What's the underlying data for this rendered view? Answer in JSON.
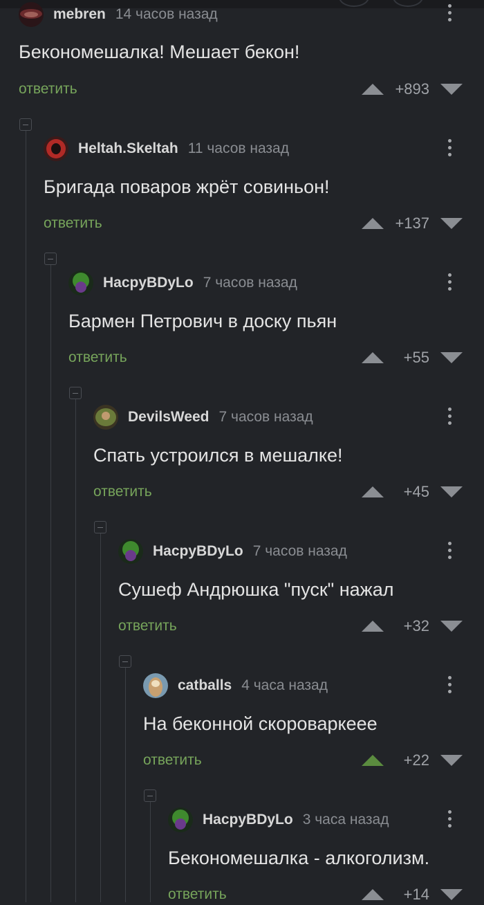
{
  "reply_label": "ответить",
  "colors": {
    "background": "#222428",
    "reply_green": "#77a55b",
    "upvote_active": "#5b8c3f",
    "muted": "#8a8d92"
  },
  "comments": [
    {
      "username": "mebren",
      "time": "14 часов назад",
      "text": "Бекономешалка! Мешает бекон!",
      "score": "+893",
      "upvoted": false,
      "avatar": "mebren-avatar"
    },
    {
      "username": "Heltah.Skeltah",
      "time": "11 часов назад",
      "text": "Бригада поваров жрёт совиньон!",
      "score": "+137",
      "upvoted": false,
      "avatar": "heltah-avatar"
    },
    {
      "username": "HacpyBDyLo",
      "time": "7 часов назад",
      "text": "Бармен Петрович в доску пьян",
      "score": "+55",
      "upvoted": false,
      "avatar": "hacpy-avatar"
    },
    {
      "username": "DevilsWeed",
      "time": "7 часов назад",
      "text": "Спать устроился в мешалке!",
      "score": "+45",
      "upvoted": false,
      "avatar": "devilsweed-avatar"
    },
    {
      "username": "HacpyBDyLo",
      "time": "7 часов назад",
      "text": "Сушеф Андрюшка \"пуск\" нажал",
      "score": "+32",
      "upvoted": false,
      "avatar": "hacpy-avatar"
    },
    {
      "username": "catballs",
      "time": "4 часа назад",
      "text": "На беконной скороваркеее",
      "score": "+22",
      "upvoted": true,
      "avatar": "catballs-avatar"
    },
    {
      "username": "HacpyBDyLo",
      "time": "3 часа назад",
      "text": "Бекономешалка - алкоголизм.",
      "score": "+14",
      "upvoted": false,
      "avatar": "hacpy-avatar"
    }
  ]
}
